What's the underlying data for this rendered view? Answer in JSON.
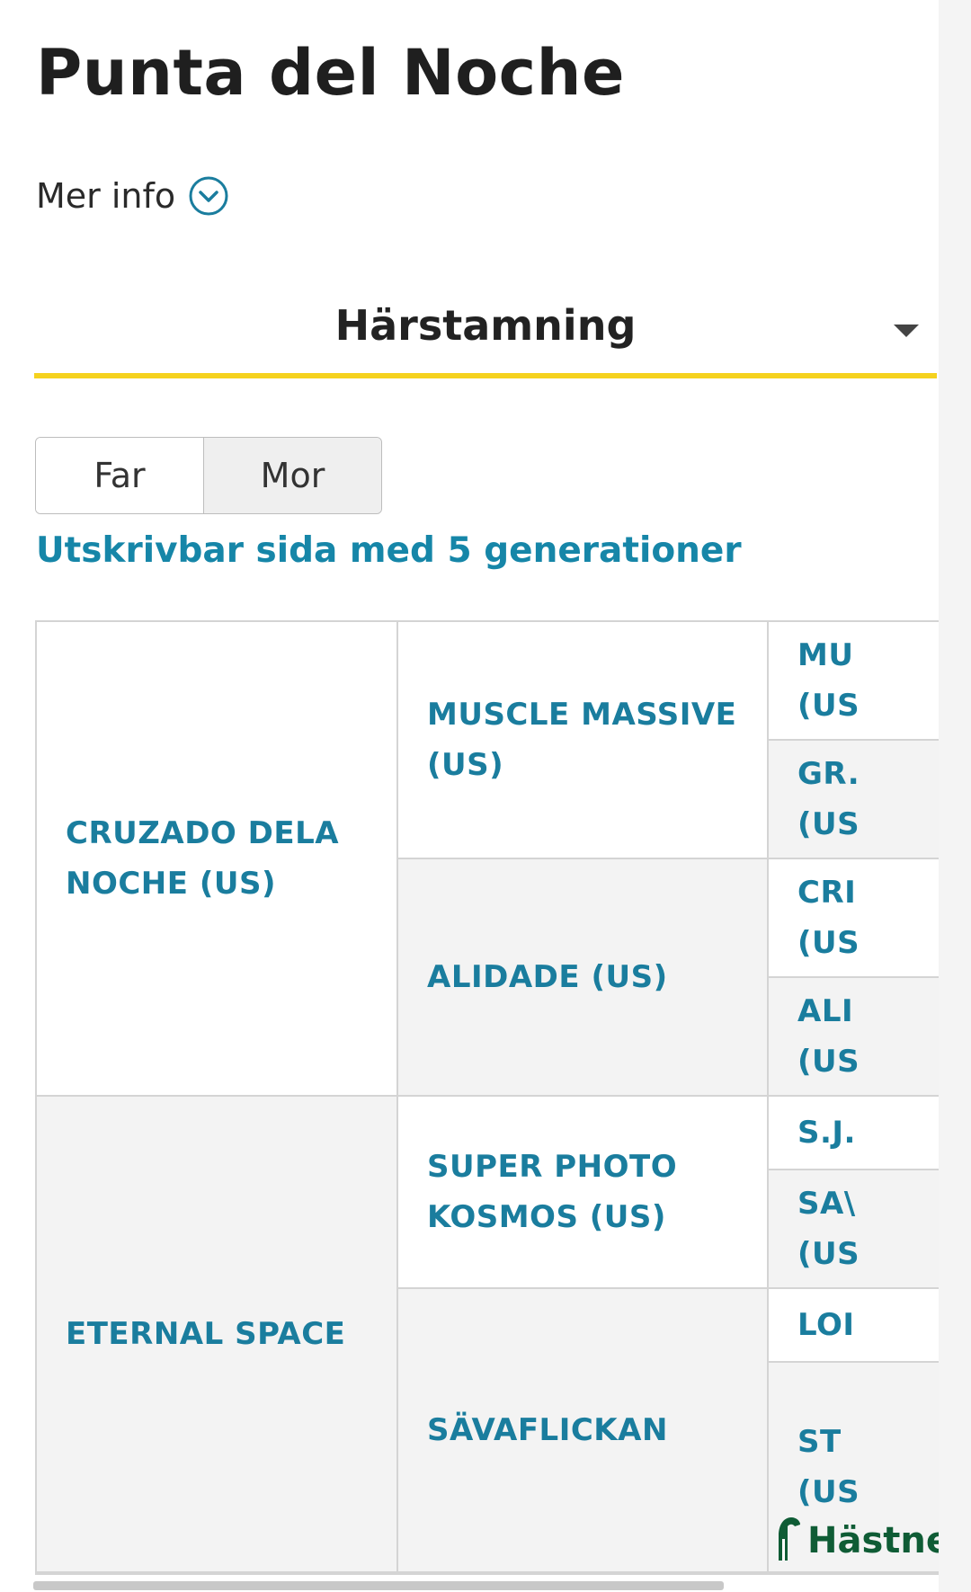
{
  "header": {
    "title": "Punta del Noche"
  },
  "more_info": {
    "label": "Mer info",
    "icon": "chevron-down-circle-icon"
  },
  "section_select": {
    "selected": "Härstamning"
  },
  "parent_toggle": {
    "options": [
      "Far",
      "Mor"
    ],
    "selected": "Mor"
  },
  "print_link": {
    "label": "Utskrivbar sida med 5 generationer"
  },
  "pedigree": {
    "gen1": [
      {
        "name": "CRUZADO DELA NOCHE (US)"
      },
      {
        "name": "ETERNAL SPACE"
      }
    ],
    "gen2": [
      {
        "name": "MUSCLE MASSIVE (US)"
      },
      {
        "name": "ALIDADE (US)"
      },
      {
        "name": "SUPER PHOTO KOSMOS (US)"
      },
      {
        "name": "SÄVAFLICKAN"
      }
    ],
    "gen3": [
      {
        "name": "MU\n(US"
      },
      {
        "name": "GR.\n(US"
      },
      {
        "name": "CRI\n(US"
      },
      {
        "name": "ALI\n(US"
      },
      {
        "name": "S.J."
      },
      {
        "name": "SA\\\n(US"
      },
      {
        "name": "LOI"
      },
      {
        "name": "ST\n(US"
      }
    ]
  },
  "brand": {
    "logo_text": "Hästnet",
    "color": "#0f5c35"
  },
  "colors": {
    "link": "#1a7d9e",
    "accent_underline": "#f5d21e"
  }
}
